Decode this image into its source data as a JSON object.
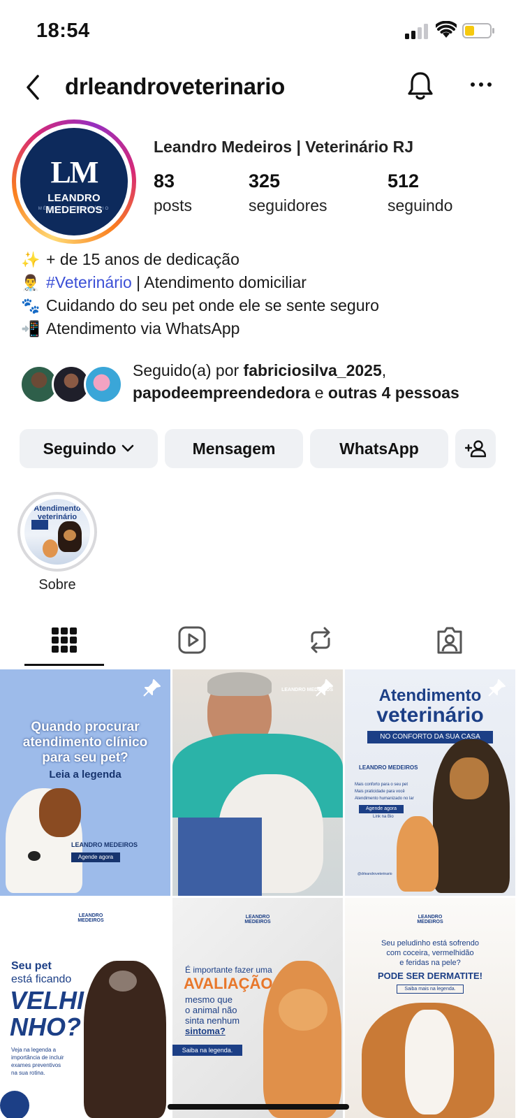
{
  "status_bar": {
    "time": "18:54"
  },
  "header": {
    "username": "drleandroveterinario"
  },
  "profile": {
    "avatar_initials": "LM",
    "avatar_name": "LEANDRO MEDEIROS",
    "avatar_subtitle": "MÉDICO VETERINÁRIO",
    "full_name": "Leandro Medeiros | Veterinário RJ",
    "stats": [
      {
        "value": "83",
        "label": "posts"
      },
      {
        "value": "325",
        "label": "seguidores"
      },
      {
        "value": "512",
        "label": "seguindo"
      }
    ]
  },
  "bio": {
    "lines": [
      {
        "emoji": "✨",
        "text": "+ de 15 anos de dedicação"
      },
      {
        "emoji": "👨‍⚕️",
        "hashtag": "#Veterinário",
        "text": " | Atendimento domiciliar"
      },
      {
        "emoji": "🐾",
        "text": "Cuidando do seu pet onde ele se sente seguro"
      },
      {
        "emoji": "📲",
        "text": "Atendimento via WhatsApp"
      }
    ]
  },
  "followed_by": {
    "prefix": "Seguido(a) por ",
    "user1": "fabriciosilva_2025",
    "sep": ",",
    "user2": "papodeempreendedora",
    "conj": " e ",
    "others": "outras 4 pessoas"
  },
  "buttons": {
    "following": "Seguindo",
    "message": "Mensagem",
    "whatsapp": "WhatsApp"
  },
  "highlights": [
    {
      "label": "Sobre",
      "image_text": "Atendimento veterinário"
    }
  ],
  "posts": {
    "p1": {
      "line1": "Quando procurar",
      "line2": "atendimento clínico",
      "line3": "para seu pet?",
      "sub": "Leia a legenda",
      "brand": "LEANDRO MEDEIROS",
      "cta": "Agende agora"
    },
    "p2": {
      "watermark": "LEANDRO MEDEIROS"
    },
    "p3": {
      "title1": "Atendimento",
      "title2": "veterinário",
      "banner": "NO CONFORTO DA SUA CASA",
      "brand": "LEANDRO MEDEIROS",
      "b1": "Mais conforto para o seu pet",
      "b2": "Mais praticidade para você",
      "b3": "Atendimento humanizado no lar",
      "cta": "Agende agora",
      "link": "Link na Bio",
      "handle": "@drleandroveterinario"
    },
    "p4": {
      "brand": "LEANDRO MEDEIROS",
      "l1": "Seu pet",
      "l2": "está ficando",
      "big1": "VELHI",
      "big2": "NHO?",
      "s1": "Veja na legenda a",
      "s2": "importância de incluir",
      "s3": "exames preventivos",
      "s4": "na sua rotina."
    },
    "p5": {
      "brand": "LEANDRO MEDEIROS",
      "l1": "É importante fazer uma",
      "big": "AVALIAÇÃO",
      "l2": "mesmo que",
      "l3": "o animal não",
      "l4": "sinta nenhum",
      "l5": "sintoma?",
      "cta": "Saiba na legenda."
    },
    "p6": {
      "brand": "LEANDRO MEDEIROS",
      "l1": "Seu peludinho está sofrendo",
      "l2": "com coceira, vermelhidão",
      "l3": "e feridas na pele?",
      "big": "PODE SER DERMATITE!",
      "cta": "Saiba mais na legenda."
    }
  }
}
